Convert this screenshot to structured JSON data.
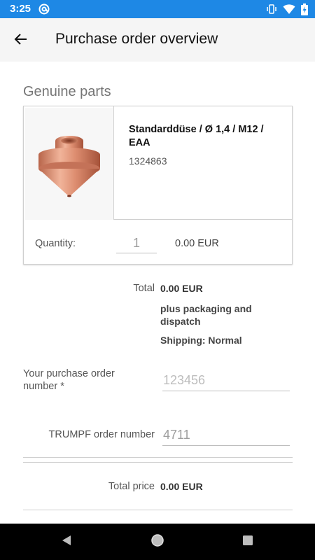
{
  "status_bar": {
    "time": "3:25",
    "app_icon": "at-sign-icon",
    "icons": [
      "vibrate-icon",
      "wifi-icon",
      "battery-charging-icon"
    ],
    "color": "#1e88e5"
  },
  "app_bar": {
    "back_icon": "arrow-left-icon",
    "title": "Purchase order overview"
  },
  "section": {
    "title": "Genuine parts"
  },
  "part": {
    "name": "Standarddüse / Ø 1,4 / M12 / EAA",
    "number": "1324863",
    "image": "copper-nozzle-image",
    "quantity_label": "Quantity:",
    "quantity_value": "1",
    "price": "0.00 EUR"
  },
  "totals": {
    "total_label": "Total",
    "total_value": "0.00 EUR",
    "shipping_note": "plus packaging and dispatch",
    "shipping_method": "Shipping: Normal"
  },
  "order": {
    "po_label": "Your purchase order number *",
    "po_placeholder": "123456",
    "trumpf_label": "TRUMPF order number",
    "trumpf_value": "4711"
  },
  "total_price": {
    "label": "Total price",
    "value": "0.00 EUR"
  },
  "nav_bar": {
    "buttons": [
      "back-triangle-icon",
      "home-circle-icon",
      "recents-square-icon"
    ]
  }
}
